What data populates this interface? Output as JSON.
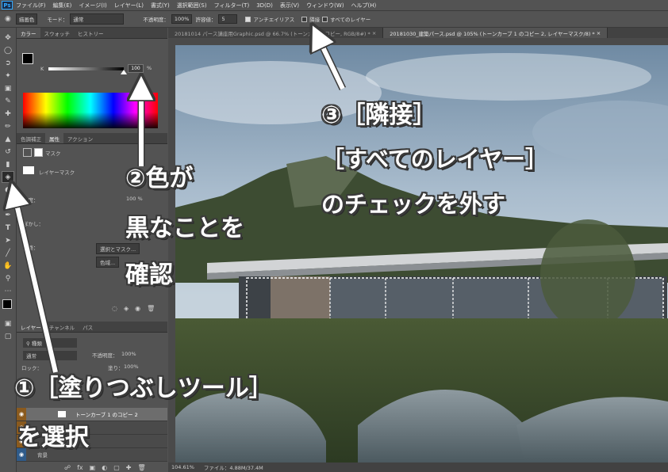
{
  "menu": {
    "app_icon": "Ps",
    "items": [
      "ファイル(F)",
      "編集(E)",
      "イメージ(I)",
      "レイヤー(L)",
      "書式(Y)",
      "選択範囲(S)",
      "フィルター(T)",
      "3D(D)",
      "表示(V)",
      "ウィンドウ(W)",
      "ヘルプ(H)"
    ]
  },
  "options": {
    "fill_source": "描画色",
    "mode_label": "モード：",
    "mode_value": "通常",
    "opacity_label": "不透明度：",
    "opacity_value": "100%",
    "tolerance_label": "許容値：",
    "tolerance_value": "5",
    "antialias_label": "アンチエイリアス",
    "contiguous_label": "隣接",
    "all_layers_label": "すべてのレイヤー"
  },
  "color_panel": {
    "tabs": [
      "カラー",
      "スウォッチ",
      "ヒストリー"
    ],
    "channel": "K",
    "value": "100",
    "unit": "%"
  },
  "properties_panel": {
    "tabs": [
      "色調補正",
      "属性",
      "アクション"
    ],
    "mask_label": "マスク",
    "layer_mask_label": "レイヤーマスク",
    "density_label": "濃度：",
    "density_value": "100 %",
    "feather_label": "ぼかし：",
    "refine_label": "調整：",
    "select_mask_button": "選択とマスク...",
    "color_range_button": "色域..."
  },
  "layers_panel": {
    "tabs": [
      "レイヤー",
      "チャンネル",
      "パス"
    ],
    "filter_label": "種類",
    "blend_mode": "通常",
    "opacity_label": "不透明度：",
    "opacity_value": "100%",
    "lock_label": "ロック：",
    "fill_label": "塗り：",
    "fill_value": "100%",
    "layers": [
      {
        "name": "トーンカーブ 1 のコピー 2",
        "selected": true
      },
      {
        "name": "",
        "selected": false
      },
      {
        "name": "",
        "selected": false
      },
      {
        "name": "背景",
        "selected": false
      }
    ]
  },
  "document": {
    "tabs": [
      {
        "title": "20181014 パース講座用Graphic.psd @ 66.7% (トーンカー… コピー, RGB/8#) *",
        "active": false
      },
      {
        "title": "20181030_建築パース.psd @ 105% (トーンカーブ 1 のコピー 2, レイヤーマスク/8) *",
        "active": true
      }
    ],
    "zoom": "104.61%",
    "file_info": "ファイル：4.88M/37.4M"
  },
  "annotations": {
    "step1_line1": "①［塗りつぶしツール］",
    "step1_line2": "を選択",
    "step2_line1": "②色が",
    "step2_line2": "黒なことを",
    "step2_line3": "確認",
    "step3_line1": "③［隣接］",
    "step3_line2": "［すべてのレイヤー］",
    "step3_line3": "のチェックを外す"
  },
  "colors": {
    "ui_bg": "#535353",
    "panel_dark": "#424242",
    "annotation_text": "#ffffff",
    "annotation_outline": "#3a3a3a",
    "layer_eye": "#8a5a1e"
  },
  "icons": {
    "tools": [
      "move-icon",
      "marquee-icon",
      "lasso-icon",
      "magic-wand-icon",
      "crop-icon",
      "eyedropper-icon",
      "healing-icon",
      "brush-icon",
      "stamp-icon",
      "history-brush-icon",
      "eraser-icon",
      "paint-bucket-icon",
      "blur-icon",
      "dodge-icon",
      "pen-icon",
      "type-icon",
      "path-select-icon",
      "line-icon",
      "hand-icon",
      "zoom-icon",
      "more-icon"
    ]
  }
}
